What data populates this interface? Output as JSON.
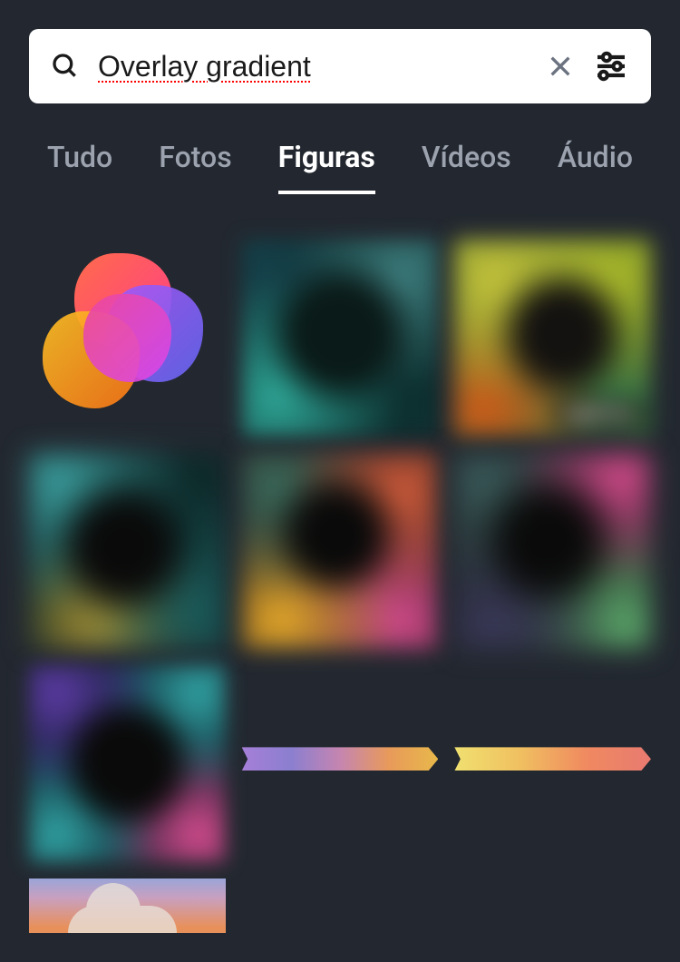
{
  "search": {
    "value": "Overlay gradient",
    "placeholder": ""
  },
  "tabs": [
    {
      "label": "Tudo",
      "active": false
    },
    {
      "label": "Fotos",
      "active": false
    },
    {
      "label": "Figuras",
      "active": true
    },
    {
      "label": "Vídeos",
      "active": false
    },
    {
      "label": "Áudio",
      "active": false
    }
  ],
  "badges": {
    "free": "GRÁTIS"
  },
  "results": [
    {
      "kind": "gradient-blob-shape",
      "badge": null
    },
    {
      "kind": "blurred-gradient-teal-dark",
      "badge": null
    },
    {
      "kind": "blurred-gradient-olive-orange",
      "badge": "free"
    },
    {
      "kind": "blurred-gradient-teal-yellow",
      "badge": null
    },
    {
      "kind": "blurred-gradient-multicolor",
      "badge": null
    },
    {
      "kind": "blurred-gradient-pink-green",
      "badge": null
    },
    {
      "kind": "blurred-gradient-frame",
      "badge": null
    },
    {
      "kind": "gradient-arrow-strip-purple",
      "badge": null
    },
    {
      "kind": "gradient-arrow-strip-yellow",
      "badge": null
    },
    {
      "kind": "gradient-sky-cloud",
      "badge": null
    }
  ]
}
